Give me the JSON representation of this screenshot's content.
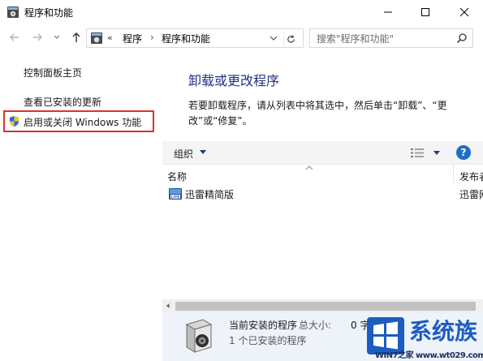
{
  "window": {
    "title": "程序和功能"
  },
  "address": {
    "overflow": "«",
    "crumbs": [
      "程序",
      "程序和功能"
    ],
    "separator": "›"
  },
  "search": {
    "placeholder": "搜索\"程序和功能\""
  },
  "sidebar": {
    "items": [
      {
        "label": "控制面板主页"
      },
      {
        "label": "查看已安装的更新"
      },
      {
        "label": "启用或关闭 Windows 功能"
      }
    ]
  },
  "main": {
    "title": "卸载或更改程序",
    "description": "若要卸载程序，请从列表中将其选中，然后单击“卸载”、“更改”或“修复”。"
  },
  "toolbar": {
    "organize_label": "组织",
    "help_label": "?"
  },
  "list": {
    "columns": [
      "名称",
      "发布者"
    ],
    "rows": [
      {
        "name": "迅雷精简版",
        "publisher": "迅雷网络"
      }
    ]
  },
  "details": {
    "label": "当前安装的程序",
    "size_label": "总大小:",
    "size_value": "0 字节",
    "count_text": "1 个已安装的程序"
  },
  "watermark": {
    "title": "系统族",
    "url": "WIN7之家 www.wt029.com"
  },
  "colors": {
    "title_blue": "#1e3287",
    "highlight_red": "#d9342b",
    "details_bg": "#eef3fa",
    "help_blue": "#1f6fc5"
  }
}
